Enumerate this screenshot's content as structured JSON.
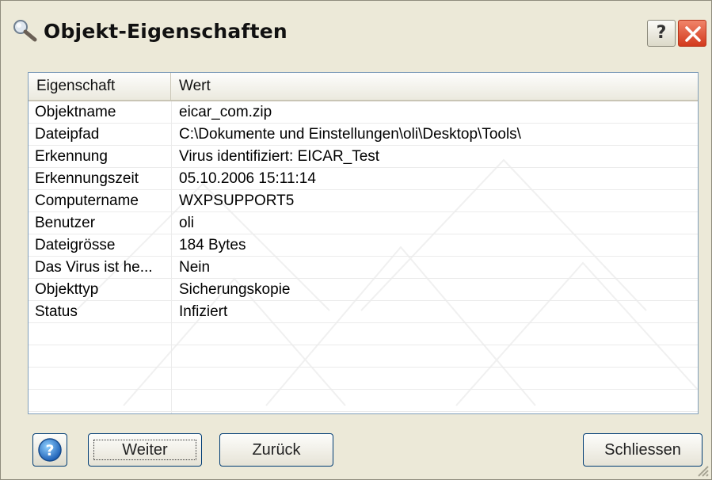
{
  "window": {
    "title": "Objekt-Eigenschaften",
    "title_icon": "magnifier-icon",
    "help_label": "?",
    "close_icon": "close-icon"
  },
  "table": {
    "columns": [
      "Eigenschaft",
      "Wert"
    ],
    "rows": [
      {
        "property": "Objektname",
        "value": "eicar_com.zip"
      },
      {
        "property": "Dateipfad",
        "value": "C:\\Dokumente und Einstellungen\\oli\\Desktop\\Tools\\"
      },
      {
        "property": "Erkennung",
        "value": "Virus identifiziert: EICAR_Test"
      },
      {
        "property": "Erkennungszeit",
        "value": "05.10.2006 15:11:14"
      },
      {
        "property": "Computername",
        "value": "WXPSUPPORT5"
      },
      {
        "property": "Benutzer",
        "value": "oli"
      },
      {
        "property": "Dateigrösse",
        "value": "184 Bytes"
      },
      {
        "property": "Das Virus ist he...",
        "value": "Nein"
      },
      {
        "property": "Objekttyp",
        "value": "Sicherungskopie"
      },
      {
        "property": "Status",
        "value": "Infiziert"
      },
      {
        "property": "",
        "value": ""
      },
      {
        "property": "",
        "value": ""
      },
      {
        "property": "",
        "value": ""
      },
      {
        "property": "",
        "value": ""
      }
    ]
  },
  "footer": {
    "info_icon": "help-circle-icon",
    "next_label": "Weiter",
    "back_label": "Zurück",
    "close_label": "Schliessen"
  },
  "colors": {
    "dialog_bg": "#ece9d8",
    "close_red": "#d2391c",
    "list_border": "#7f9db9"
  }
}
